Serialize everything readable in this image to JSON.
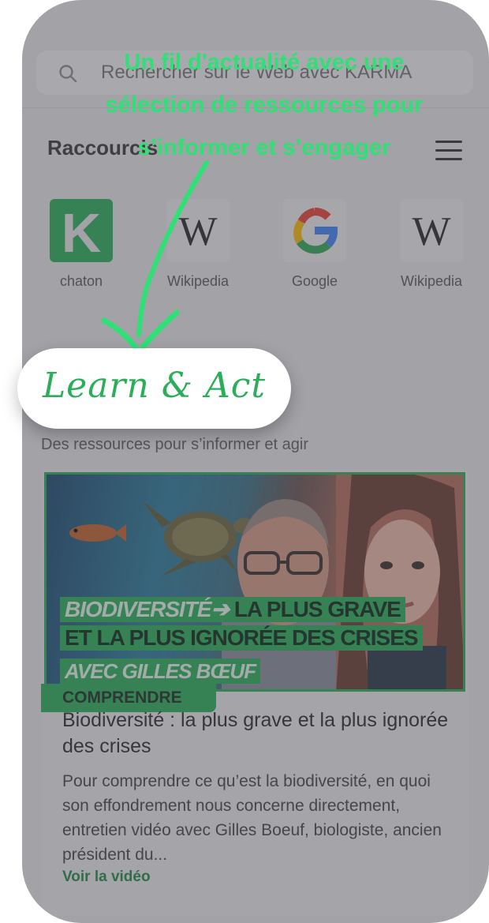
{
  "search": {
    "placeholder": "Rechercher sur le Web avec KARMA",
    "icon": "search-icon"
  },
  "shortcuts": {
    "title": "Raccourcis",
    "items": [
      {
        "label": "chaton",
        "icon": "karma-k-icon"
      },
      {
        "label": "Wikipedia",
        "icon": "wikipedia-w-icon"
      },
      {
        "label": "Google",
        "icon": "google-g-icon"
      },
      {
        "label": "Wikipedia",
        "icon": "wikipedia-w-icon"
      }
    ]
  },
  "annotation": {
    "line1": "Un fil d'actualité avec une",
    "line2": "sélection de ressources pour",
    "line3": "s’informer et s’engager"
  },
  "badge": {
    "label": "Learn & Act"
  },
  "feed": {
    "subtitle": "Des ressources pour s’informer et agir",
    "card": {
      "thumb_line1_a": "BIODIVERSITÉ➔",
      "thumb_line1_b": " LA PLUS GRAVE",
      "thumb_line2": "ET LA PLUS IGNORÉE DES CRISES",
      "thumb_line3": "AVEC GILLES BŒUF",
      "tag": "COMPRENDRE",
      "title": "Biodiversité : la plus grave et la plus ignorée des crises",
      "description": "Pour comprendre ce qu’est la biodiversité, en quoi son effondrement nous concerne directement, entretien vidéo avec Gilles Boeuf, biologiste, ancien président du...",
      "link": "Voir la vidéo"
    }
  },
  "colors": {
    "accent": "#2bae58",
    "annotation": "#2ee076"
  }
}
